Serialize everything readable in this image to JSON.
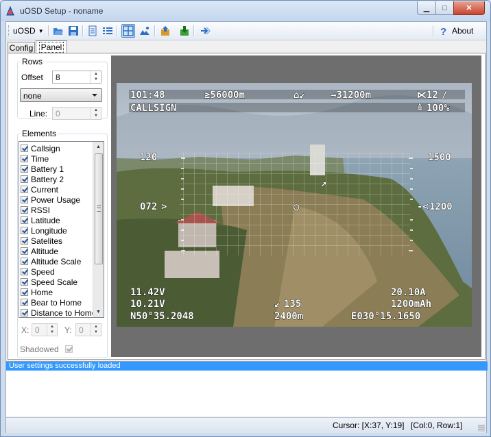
{
  "window": {
    "title": "uOSD Setup - noname"
  },
  "toolbar": {
    "menu_label": "uOSD",
    "about_label": "About",
    "buttons": [
      "open-icon",
      "save-icon",
      "document-icon",
      "list-icon",
      "grid-icon",
      "image-icon",
      "upload-icon",
      "download-icon",
      "connect-icon"
    ]
  },
  "tabs": [
    {
      "label": "Config"
    },
    {
      "label": "Panel"
    }
  ],
  "rows_group": {
    "legend": "Rows",
    "offset_label": "Offset",
    "offset_value": "8",
    "mode_value": "none",
    "line_label": "Line:",
    "line_value": "0"
  },
  "elements_group": {
    "legend": "Elements",
    "items": [
      {
        "label": "Callsign",
        "checked": true
      },
      {
        "label": "Time",
        "checked": true
      },
      {
        "label": "Battery 1",
        "checked": true
      },
      {
        "label": "Battery 2",
        "checked": true
      },
      {
        "label": "Current",
        "checked": true
      },
      {
        "label": "Power Usage",
        "checked": true
      },
      {
        "label": "RSSI",
        "checked": true
      },
      {
        "label": "Latitude",
        "checked": true
      },
      {
        "label": "Longitude",
        "checked": true
      },
      {
        "label": "Satelites",
        "checked": true
      },
      {
        "label": "Altitude",
        "checked": true
      },
      {
        "label": "Altitude Scale",
        "checked": true
      },
      {
        "label": "Speed",
        "checked": true
      },
      {
        "label": "Speed Scale",
        "checked": true
      },
      {
        "label": "Home",
        "checked": true
      },
      {
        "label": "Bear to Home",
        "checked": true
      },
      {
        "label": "Distance to Home",
        "checked": true
      }
    ],
    "x_label": "X:",
    "x_value": "0",
    "y_label": "Y:",
    "y_value": "0",
    "shadowed_label": "Shadowed"
  },
  "osd": {
    "time": "101:48",
    "max_dist": "≥56000m",
    "home_dist": "→31200m",
    "sats": "12",
    "callsign": "CALLSIGN",
    "rssi": "100%",
    "speed": "120",
    "altitude": "1500",
    "heading": "072",
    "heading_r": "1200",
    "batt1": "11.42V",
    "current": "20.10A",
    "batt2": "10.21V",
    "bearing": "135",
    "mah": "1200mAh",
    "lat": "N50°35.2048",
    "dist": "2400m",
    "lon": "E030°15.1650"
  },
  "status": {
    "message": "User settings successfully loaded",
    "cursor": "Cursor: [X:37, Y:19]",
    "cell": "[Col:0, Row:1]"
  }
}
